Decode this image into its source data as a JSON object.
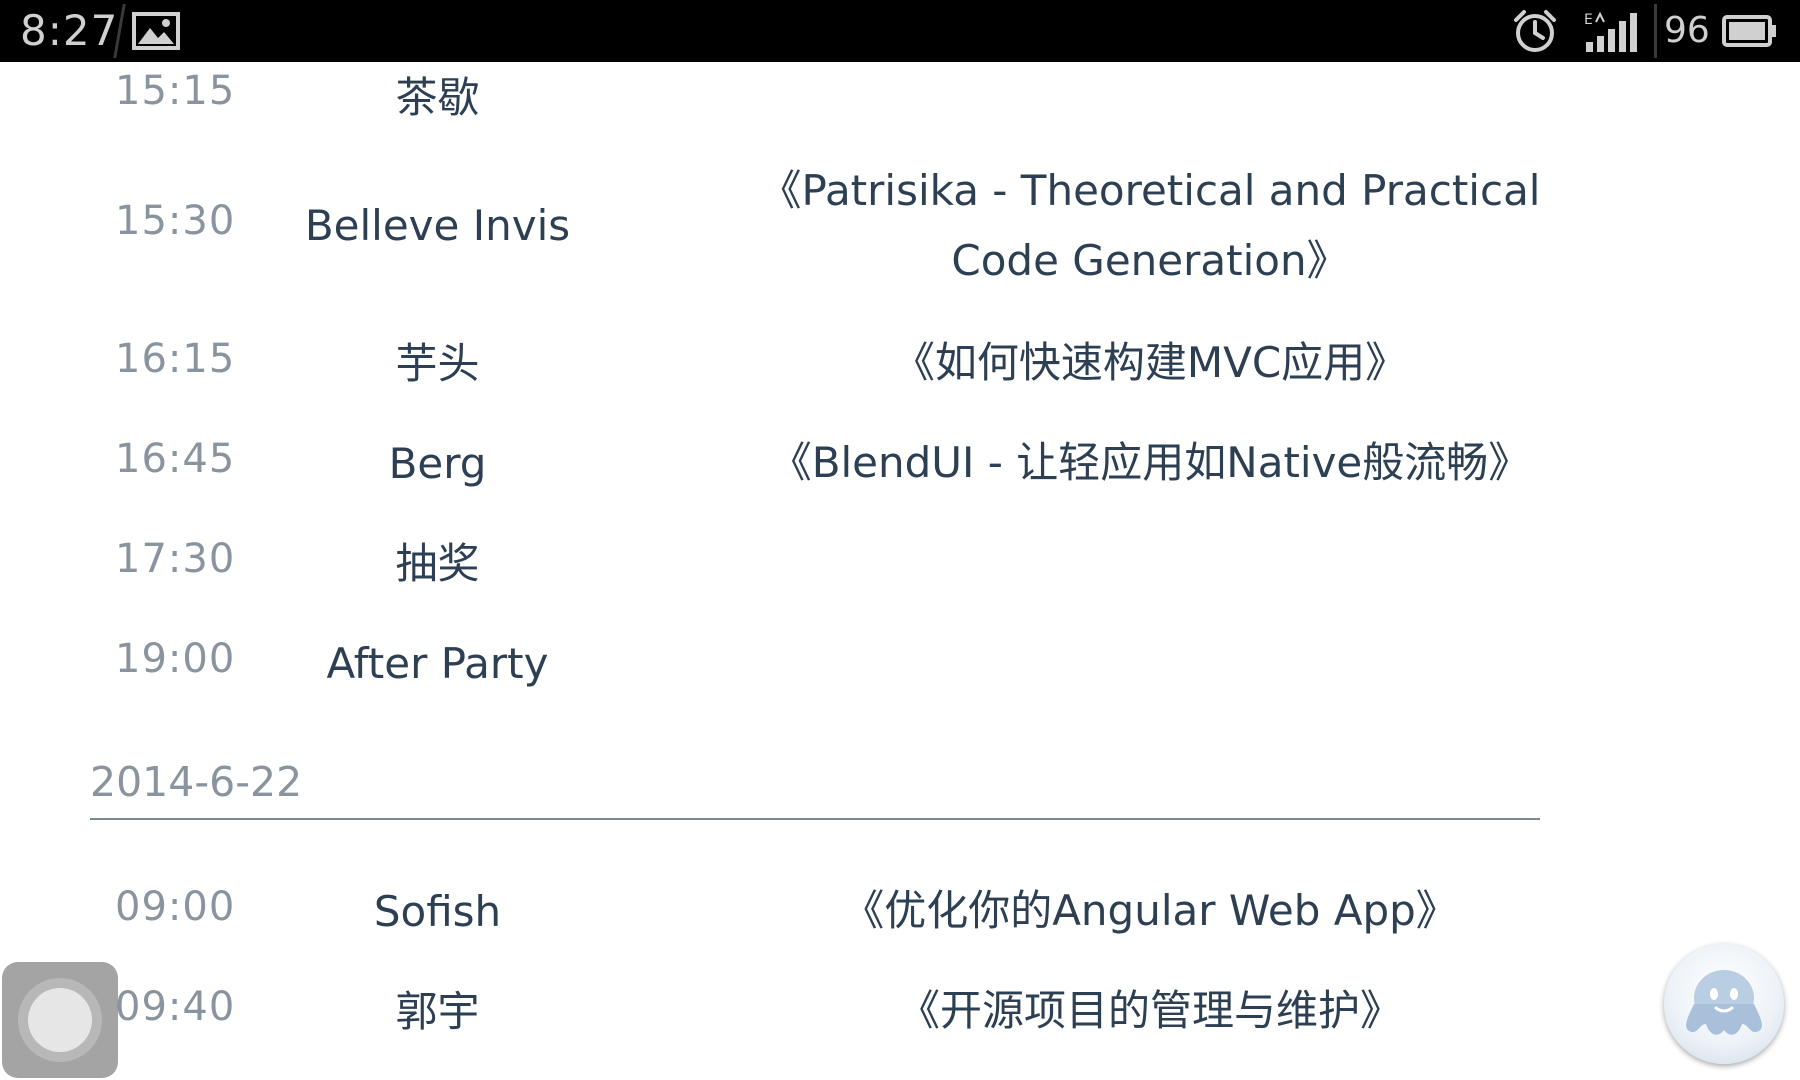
{
  "status_bar": {
    "time": "8:27",
    "battery_level": "96",
    "icons": [
      "image-icon",
      "alarm-icon",
      "signal-icon",
      "battery-icon"
    ]
  },
  "schedule": {
    "rows_day1": [
      {
        "time": "15:15",
        "speaker": "茶歇",
        "topic": ""
      },
      {
        "time": "15:30",
        "speaker": "Belleve Invis",
        "topic": "《Patrisika - Theoretical and Practical Code Generation》"
      },
      {
        "time": "16:15",
        "speaker": "芋头",
        "topic": "《如何快速构建MVC应用》"
      },
      {
        "time": "16:45",
        "speaker": "Berg",
        "topic": "《BlendUI - 让轻应用如Native般流畅》"
      },
      {
        "time": "17:30",
        "speaker": "抽奖",
        "topic": ""
      },
      {
        "time": "19:00",
        "speaker": "After Party",
        "topic": ""
      }
    ],
    "day2_heading": "2014-6-22",
    "rows_day2": [
      {
        "time": "09:00",
        "speaker": "Sofish",
        "topic": "《优化你的Angular Web App》"
      },
      {
        "time": "09:40",
        "speaker": "郭宇",
        "topic": "《开源项目的管理与维护》"
      }
    ]
  },
  "floating": {
    "left_button": "assistive-touch-icon",
    "right_button": "qq-icon"
  },
  "colors": {
    "time_text": "#8a949e",
    "body_text": "#2d3f52",
    "status_bar_bg": "#000000"
  }
}
